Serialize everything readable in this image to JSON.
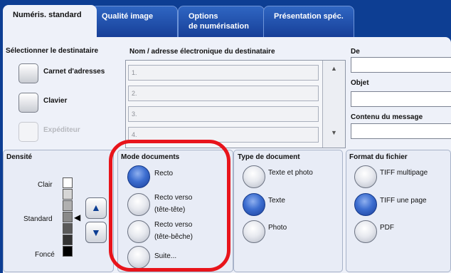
{
  "tabs": [
    {
      "label": "Numéris. standard"
    },
    {
      "label": "Qualité image"
    },
    {
      "label": "Options\nde numérisation"
    },
    {
      "label": "Présentation spéc."
    }
  ],
  "destination": {
    "title": "Sélectionner le destinataire",
    "address_book": "Carnet d'adresses",
    "keyboard": "Clavier",
    "sender": "Expéditeur"
  },
  "recipient": {
    "title": "Nom / adresse électronique du destinataire",
    "rows": [
      "1.",
      "2.",
      "3.",
      "4."
    ]
  },
  "from": {
    "label": "De",
    "value": ""
  },
  "subject": {
    "label": "Objet",
    "value": ""
  },
  "message": {
    "label": "Contenu du message",
    "value": ""
  },
  "density": {
    "title": "Densité",
    "light": "Clair",
    "standard": "Standard",
    "dark": "Foncé"
  },
  "document_mode": {
    "title": "Mode documents",
    "options": [
      "Recto",
      "Recto verso\n(tête-tête)",
      "Recto verso\n(tête-bêche)",
      "Suite..."
    ],
    "selected": "Recto"
  },
  "document_type": {
    "title": "Type de document",
    "options": [
      "Texte et photo",
      "Texte",
      "Photo"
    ],
    "selected": "Texte"
  },
  "file_format": {
    "title": "Format du fichier",
    "options": [
      "TIFF multipage",
      "TIFF une page",
      "PDF"
    ],
    "selected": "TIFF une page"
  },
  "colors": {
    "highlight": "#e8141b",
    "tab_bar": "#0d3e93",
    "selected_radio": "#3d6ed0"
  }
}
